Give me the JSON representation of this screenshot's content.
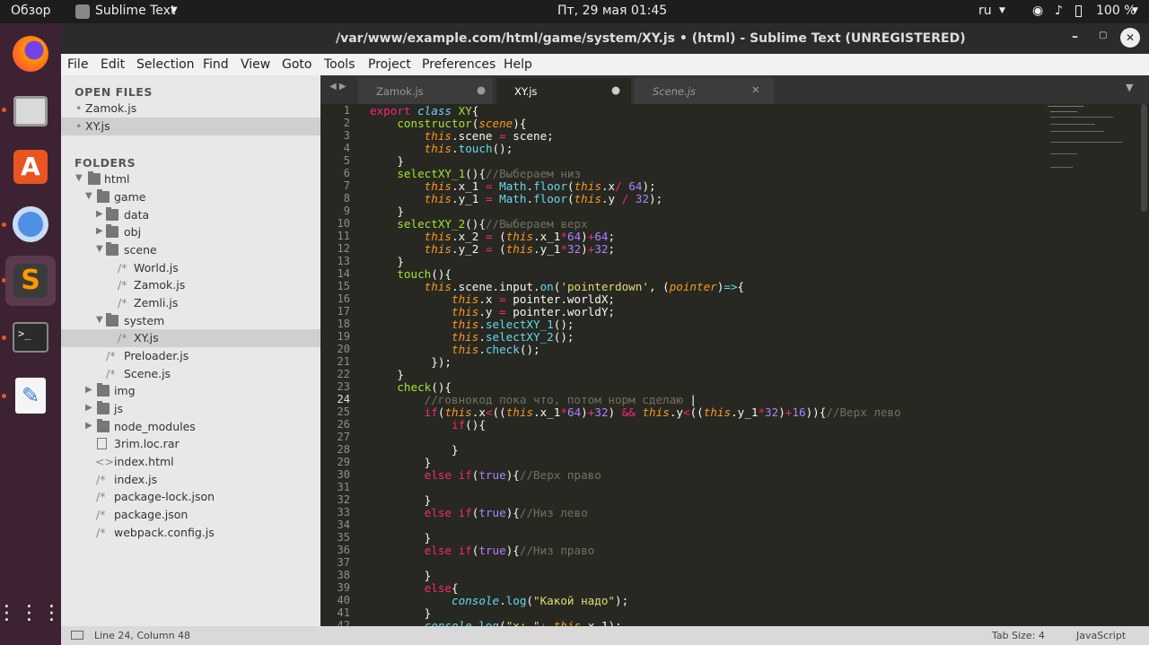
{
  "topbar": {
    "overview": "Обзор",
    "app": "Sublime Text",
    "clock": "Пт, 29 мая  01:45",
    "lang": "ru",
    "battery": "100 %"
  },
  "window": {
    "title": "/var/www/example.com/html/game/system/XY.js • (html) - Sublime Text (UNREGISTERED)"
  },
  "menu": [
    "File",
    "Edit",
    "Selection",
    "Find",
    "View",
    "Goto",
    "Tools",
    "Project",
    "Preferences",
    "Help"
  ],
  "sidebar": {
    "open_files_label": "OPEN FILES",
    "open_files": [
      "Zamok.js",
      "XY.js"
    ],
    "folders_label": "FOLDERS",
    "tree": [
      "html",
      "game",
      "data",
      "obj",
      "scene",
      "World.js",
      "Zamok.js",
      "Zemli.js",
      "system",
      "XY.js",
      "Preloader.js",
      "Scene.js",
      "img",
      "js",
      "node_modules",
      "3rim.loc.rar",
      "index.html",
      "index.js",
      "package-lock.json",
      "package.json",
      "webpack.config.js"
    ]
  },
  "tabs": [
    "Zamok.js",
    "XY.js",
    "Scene.js"
  ],
  "status": {
    "position": "Line 24, Column 48",
    "tabsize": "Tab Size: 4",
    "syntax": "JavaScript"
  },
  "code_lines": [
    "1",
    "2",
    "3",
    "4",
    "5",
    "6",
    "7",
    "8",
    "9",
    "10",
    "11",
    "12",
    "13",
    "14",
    "15",
    "16",
    "17",
    "18",
    "19",
    "20",
    "21",
    "22",
    "23",
    "24",
    "25",
    "26",
    "27",
    "28",
    "29",
    "30",
    "31",
    "32",
    "33",
    "34",
    "35",
    "36",
    "37",
    "38",
    "39",
    "40",
    "41",
    "42"
  ],
  "colors": {
    "editor_bg": "#272822",
    "accent": "#e95420"
  }
}
